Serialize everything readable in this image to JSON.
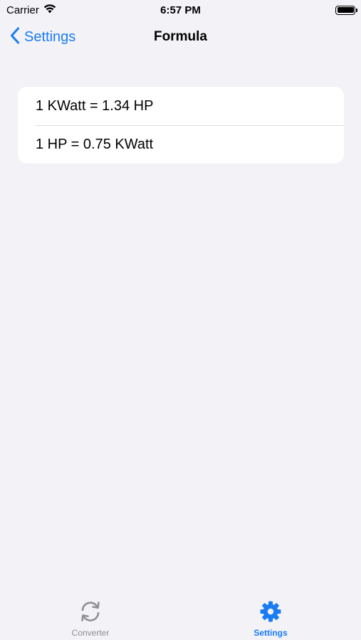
{
  "status_bar": {
    "carrier": "Carrier",
    "time": "6:57 PM",
    "icons": [
      "wifi-icon",
      "battery-icon"
    ]
  },
  "nav": {
    "back_label": "Settings",
    "title": "Formula"
  },
  "formulas": [
    {
      "text": "1 KWatt = 1.34 HP"
    },
    {
      "text": "1 HP = 0.75 KWatt"
    }
  ],
  "tab_bar": {
    "tabs": [
      {
        "label": "Converter",
        "icon": "refresh-icon",
        "selected": false
      },
      {
        "label": "Settings",
        "icon": "gear-icon",
        "selected": true
      }
    ]
  },
  "colors": {
    "accent": "#1a7cf5",
    "background": "#f2f2f7",
    "inactive": "#8e8e93"
  }
}
